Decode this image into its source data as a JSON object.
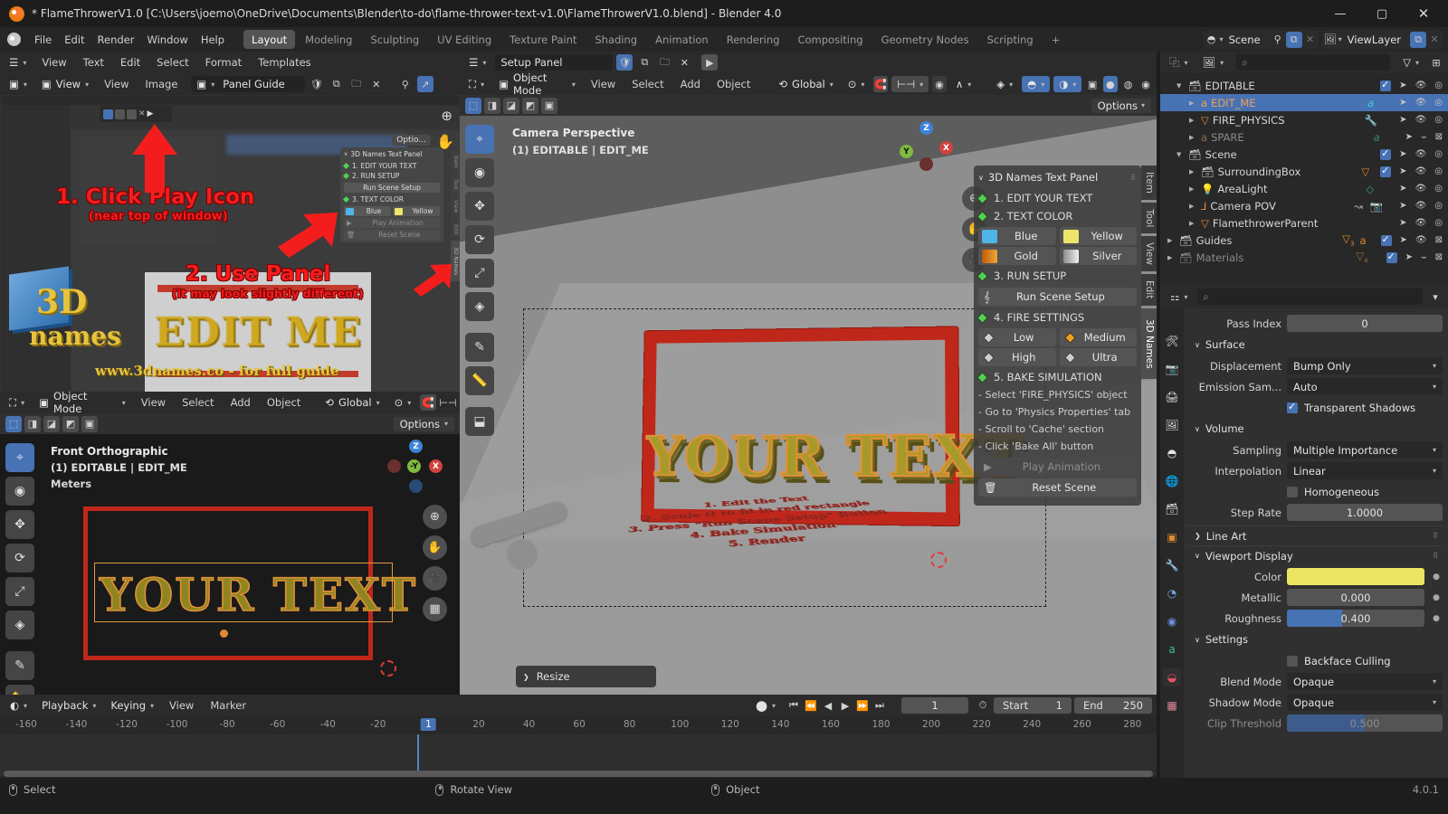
{
  "window": {
    "title": "* FlameThrowerV1.0 [C:\\Users\\joemo\\OneDrive\\Documents\\Blender\\to-do\\flame-thrower-text-v1.0\\FlameThrowerV1.0.blend] - Blender 4.0",
    "minimize": "—",
    "maximize": "▢",
    "close": "✕"
  },
  "topbar": {
    "menus": [
      "File",
      "Edit",
      "Render",
      "Window",
      "Help"
    ],
    "workspaces": [
      "Layout",
      "Modeling",
      "Sculpting",
      "UV Editing",
      "Texture Paint",
      "Shading",
      "Animation",
      "Rendering",
      "Compositing",
      "Geometry Nodes",
      "Scripting"
    ],
    "active_workspace": "Layout",
    "add_workspace": "+",
    "scene_name": "Scene",
    "viewlayer_name": "ViewLayer"
  },
  "text_editor": {
    "menus": [
      "View",
      "Text",
      "Edit",
      "Select",
      "Format",
      "Templates"
    ]
  },
  "image_editor": {
    "menus": [
      "View",
      "Image"
    ],
    "mode_label": "View",
    "image_name": "Panel Guide"
  },
  "setup_panel": {
    "text_name": "Setup Panel",
    "run_icon": "▶"
  },
  "tutorial_overlay": {
    "step1_title": "1. Click Play Icon",
    "step1_sub": "(near top of window)",
    "step2_title": "2. Use Panel",
    "step2_sub": "(it may look slightly different)",
    "logo_3d": "3D",
    "logo_names": "names",
    "edit_me": "EDIT ME",
    "website": "www.3dnames.co - for full guide",
    "mini_panel_title": "3D Names Text Panel",
    "mini_items": [
      "1. EDIT YOUR TEXT",
      "2. RUN SETUP"
    ],
    "mini_run": "Run Scene Setup",
    "mini_color_title": "3. TEXT COLOR",
    "mini_blue": "Blue",
    "mini_yellow": "Yellow",
    "mini_play": "Play Animation",
    "mini_reset": "Reset Scene",
    "mini_options": "Optio..."
  },
  "view3d_left": {
    "mode": "Object Mode",
    "menus": [
      "View",
      "Select",
      "Add",
      "Object"
    ],
    "transform_orientation": "Global",
    "options": "Options",
    "view_name": "Front Orthographic",
    "collection_object": "(1) EDITABLE | EDIT_ME",
    "units": "Meters",
    "axis_z": "Z",
    "axis_y": "-Y",
    "axis_x": "X",
    "text_object": "YOUR  TEXT"
  },
  "view3d_main": {
    "mode": "Object Mode",
    "menus": [
      "View",
      "Select",
      "Add",
      "Object"
    ],
    "transform_orientation": "Global",
    "options": "Options",
    "view_name": "Camera Perspective",
    "collection_object": "(1) EDITABLE | EDIT_ME",
    "axis_z": "Z",
    "axis_y": "Y",
    "axis_x": "X",
    "text_object": "YOUR TEXT",
    "scene_instructions": [
      "1. Edit the Text",
      "2. Scale it to fit in red rectangle",
      "3. Press \"Run Scene Setup\" Button",
      "4. Bake Simulation",
      "5. Render"
    ],
    "resize_popover": "Resize"
  },
  "npanel": {
    "title": "3D Names Text Panel",
    "step1": "1. EDIT YOUR TEXT",
    "step2": "2. TEXT COLOR",
    "colors": [
      {
        "label": "Blue",
        "hex": "#4FB4E8"
      },
      {
        "label": "Yellow",
        "hex": "#EFE46A"
      },
      {
        "label": "Gold",
        "hex": "#E8860F"
      },
      {
        "label": "Silver",
        "hex": "#C9C9C9"
      }
    ],
    "step3": "3. RUN SETUP",
    "run_setup": "Run Scene Setup",
    "step4": "4. FIRE SETTINGS",
    "fire_levels": [
      {
        "label": "Low",
        "active": false
      },
      {
        "label": "Medium",
        "active": true
      },
      {
        "label": "High",
        "active": false
      },
      {
        "label": "Ultra",
        "active": false
      }
    ],
    "step5": "5. BAKE SIMULATION",
    "bake_steps": [
      "- Select 'FIRE_PHYSICS' object",
      "- Go to 'Physics Properties' tab",
      "- Scroll to 'Cache' section",
      "- Click 'Bake All' button"
    ],
    "play_animation": "Play Animation",
    "reset_scene": "Reset Scene"
  },
  "vertical_tabs": [
    "Item",
    "Tool",
    "View",
    "Edit",
    "3D Names"
  ],
  "vertical_tabs_active": "3D Names",
  "outliner": {
    "search_placeholder": "",
    "rows": [
      {
        "name": "EDITABLE",
        "indent": 1,
        "type": "collection",
        "selected": false,
        "dim": false,
        "checkbox": true
      },
      {
        "name": "EDIT_ME",
        "indent": 2,
        "type": "text",
        "selected": true,
        "dim": false,
        "checkbox": false
      },
      {
        "name": "FIRE_PHYSICS",
        "indent": 2,
        "type": "mesh",
        "selected": false,
        "dim": false,
        "checkbox": false
      },
      {
        "name": "SPARE",
        "indent": 2,
        "type": "text",
        "selected": false,
        "dim": true,
        "checkbox": false
      },
      {
        "name": "Scene",
        "indent": 1,
        "type": "collection",
        "selected": false,
        "dim": false,
        "checkbox": true
      },
      {
        "name": "SurroundingBox",
        "indent": 2,
        "type": "collection",
        "selected": false,
        "dim": false,
        "checkbox": true
      },
      {
        "name": "AreaLight",
        "indent": 2,
        "type": "light",
        "selected": false,
        "dim": false,
        "checkbox": false
      },
      {
        "name": "Camera POV",
        "indent": 2,
        "type": "camera",
        "selected": false,
        "dim": false,
        "checkbox": false
      },
      {
        "name": "FlamethrowerParent",
        "indent": 2,
        "type": "mesh",
        "selected": false,
        "dim": false,
        "checkbox": false
      },
      {
        "name": "Guides",
        "indent": 0,
        "type": "collection",
        "selected": false,
        "dim": false,
        "checkbox": true
      },
      {
        "name": "Materials",
        "indent": 0,
        "type": "collection",
        "selected": false,
        "dim": true,
        "checkbox": true
      }
    ]
  },
  "properties": {
    "search_placeholder": "",
    "pass_index_label": "Pass Index",
    "pass_index_value": "0",
    "surface_label": "Surface",
    "displacement_label": "Displacement",
    "displacement_value": "Bump Only",
    "emission_label": "Emission Sam...",
    "emission_value": "Auto",
    "transparent_shadows_label": "Transparent Shadows",
    "transparent_shadows_on": true,
    "volume_label": "Volume",
    "sampling_label": "Sampling",
    "sampling_value": "Multiple Importance",
    "interpolation_label": "Interpolation",
    "interpolation_value": "Linear",
    "homogeneous_label": "Homogeneous",
    "homogeneous_on": false,
    "step_rate_label": "Step Rate",
    "step_rate_value": "1.0000",
    "line_art_label": "Line Art",
    "viewport_display_label": "Viewport Display",
    "color_label": "Color",
    "color_hex": "#ECE463",
    "metallic_label": "Metallic",
    "metallic_value": "0.000",
    "roughness_label": "Roughness",
    "roughness_value": "0.400",
    "roughness_fill": 40,
    "settings_label": "Settings",
    "backface_culling_label": "Backface Culling",
    "backface_culling_on": false,
    "blend_mode_label": "Blend Mode",
    "blend_mode_value": "Opaque",
    "shadow_mode_label": "Shadow Mode",
    "shadow_mode_value": "Opaque",
    "clip_threshold_label": "Clip Threshold",
    "clip_threshold_value": "0.500"
  },
  "timeline": {
    "menus": [
      "Playback",
      "Keying",
      "View",
      "Marker"
    ],
    "current_frame": "1",
    "start_label": "Start",
    "start_value": "1",
    "end_label": "End",
    "end_value": "250",
    "ticks": [
      "-160",
      "-140",
      "-120",
      "-100",
      "-80",
      "-60",
      "-40",
      "-20",
      "1",
      "20",
      "40",
      "60",
      "80",
      "100",
      "120",
      "140",
      "160",
      "180",
      "200",
      "220",
      "240",
      "260",
      "280"
    ],
    "playhead_tick": "1",
    "transport": [
      "⏮",
      "⏪",
      "◀",
      "▶",
      "⏩",
      "⏭"
    ]
  },
  "statusbar": {
    "items": [
      "Select",
      "Rotate View",
      "Object"
    ],
    "version": "4.0.1"
  }
}
